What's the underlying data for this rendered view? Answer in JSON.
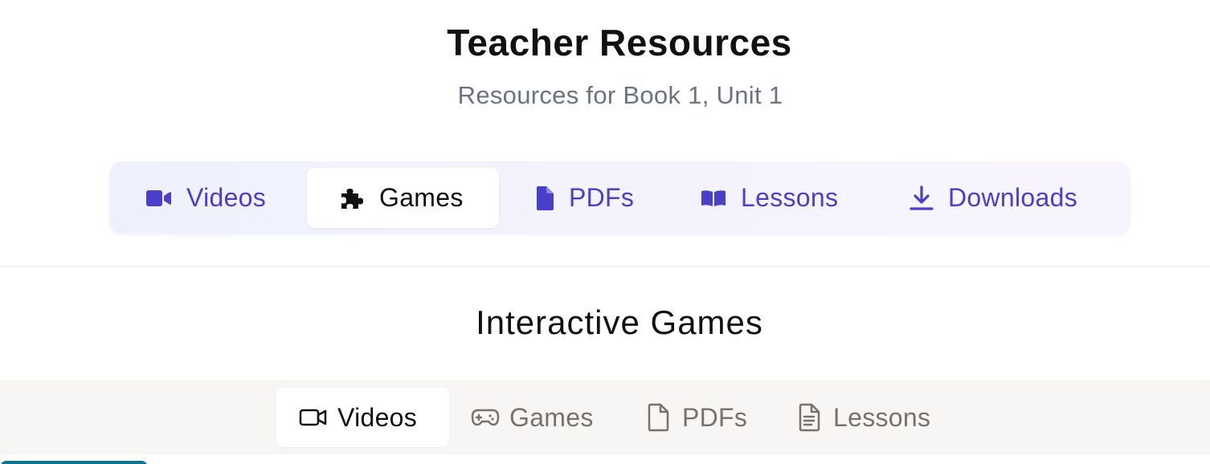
{
  "header": {
    "title": "Teacher Resources",
    "subtitle": "Resources for Book 1, Unit 1"
  },
  "primary_tabs": [
    {
      "label": "Videos",
      "icon": "video-camera-icon",
      "active": false
    },
    {
      "label": "Games",
      "icon": "puzzle-piece-icon",
      "active": true
    },
    {
      "label": "PDFs",
      "icon": "document-icon",
      "active": false
    },
    {
      "label": "Lessons",
      "icon": "open-book-icon",
      "active": false
    },
    {
      "label": "Downloads",
      "icon": "download-icon",
      "active": false
    }
  ],
  "section": {
    "title": "Interactive Games"
  },
  "secondary_tabs": [
    {
      "label": "Videos",
      "icon": "video-outline-icon",
      "active": true
    },
    {
      "label": "Games",
      "icon": "gamepad-icon",
      "active": false
    },
    {
      "label": "PDFs",
      "icon": "file-outline-icon",
      "active": false
    },
    {
      "label": "Lessons",
      "icon": "file-text-icon",
      "active": false
    }
  ],
  "colors": {
    "accent": "#4a3fc9",
    "text": "#111111",
    "muted": "#6b7280",
    "secondary_muted": "#78716c",
    "teal": "#0e7490"
  }
}
